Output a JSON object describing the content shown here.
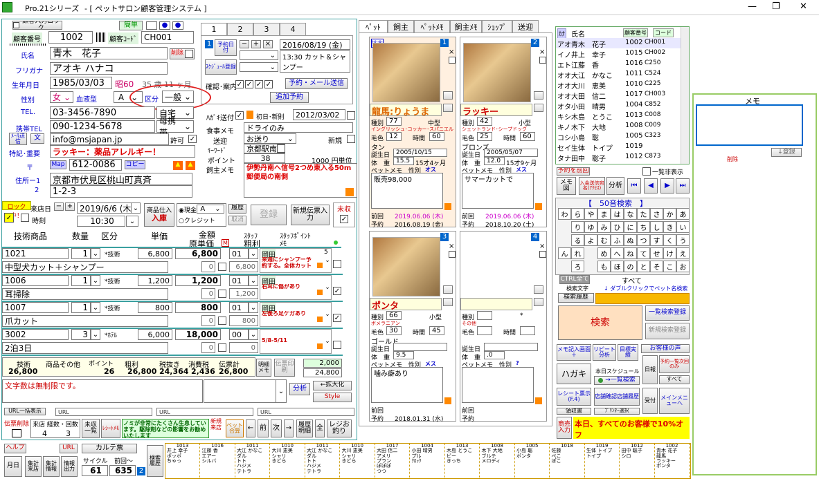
{
  "title": {
    "app": "Pro.21シリーズ",
    "system": "- [ ペットサロン顧客管理システム ]"
  },
  "win": {
    "min": "—",
    "restore": "❐",
    "close": "✕"
  },
  "top": {
    "lock_input": "顧客入力ロック",
    "id_label": "顧客番号",
    "id_value": "1002",
    "code_label": "顧客ｺｰﾄﾞ",
    "code_value": "CH001",
    "easy": "簡単"
  },
  "cust": {
    "name_label": "氏名",
    "name": "青木　花子",
    "delete": "削除",
    "furi_label": "フリガナ",
    "furi": "アオキ ハナコ",
    "dob_label": "生年月日",
    "dob": "1985/03/03",
    "era": "昭60",
    "age": "35 歳 11 ヶ月",
    "sex_label": "性別",
    "sex": "女",
    "blood_label": "血液型",
    "blood": "A",
    "kubun_label": "区分",
    "kubun": "一般",
    "tel_label": "TEL.",
    "tel": "03-3456-7890",
    "tel_type": "自宅",
    "mob_label": "携帯TEL",
    "mob": "090-1234-5678",
    "mob_type": "母携帯",
    "mail_btn": "ﾒｰﾙ送信",
    "mail_btn2": "文",
    "mail": "info@msjapan.jp",
    "permit": "許可",
    "note_label": "特記･重要",
    "note": "ラッキー：薬品アレルギー！",
    "zip_label": "〒",
    "map_btn": "Map",
    "zip": "612-0086",
    "copy_btn": "コピー",
    "addr1_label": "住所ー1",
    "addr1": "京都市伏見区桃山町真斉",
    "addr2_label": "2",
    "addr2": "1-2-3"
  },
  "tabs": {
    "t1": "1",
    "t2": "2",
    "t3": "3",
    "t4": "4"
  },
  "yoyaku": {
    "label": "予約日付",
    "minus": "−",
    "plus": "+",
    "x": "×",
    "date": "2016/08/19 (金)",
    "sched": "ｽｹｼﾞｭｰﾙ登録",
    "memo": "13:30 カット＆シャンプー",
    "confirm_label": "確認･案内",
    "mail_btn": "予約・メール送信",
    "add_btn": "追加予約"
  },
  "hagaki": {
    "label": "ﾊｶﾞｷ送付",
    "first_label": "初日･新則",
    "first_date": "2012/03/02",
    "shoku_label": "食事メモ",
    "shoku": "ドライのみ",
    "soge_label": "送迎",
    "soge": "お送り",
    "new_label": "新規",
    "kw_label": "ｷｰﾜｰﾄﾞ",
    "kw": "京都駅南口",
    "pt_label": "ポイント",
    "pt": "38",
    "pt_unit": "1000 円単位",
    "memo_label": "飼主メモ",
    "memo": "伊勢丹南へ信号2つめ東入る50m郵便局の南側"
  },
  "lock": {
    "tag": "ロック中！",
    "visit_label": "来店日",
    "date": "2019/6/6 (木)",
    "time": "10:30",
    "time_label": "時刻",
    "shiire": "商品仕入",
    "nyuko": "入庫",
    "genkin": "現金",
    "pay_a": "A",
    "credit": "クレジット",
    "rireki": "履歴",
    "torikeshi": "取消",
    "toroku": "登録",
    "new_slip": "新規伝票入力",
    "misyu": "未収"
  },
  "lines": {
    "h_item": "技術商品",
    "h_qty": "数量",
    "h_kubun": "区分",
    "h_price": "単価",
    "h_amount": "金額",
    "h_genka": "原単価",
    "h_staff": "ｽﾀｯﾌ",
    "h_arari": "粗利",
    "h_point": "ｽﾀｯﾌﾎﾟｲﾝﾄ",
    "h_memo": "ﾒﾓ",
    "h_m": "M",
    "rows": [
      {
        "code": "1021",
        "qty": "1",
        "kubun": "*技術",
        "price": "6,800",
        "amount": "6,800",
        "staff": "01",
        "name": "中型犬カット＋シャンプー",
        "genka": "0",
        "arari": "6,800",
        "sname": "岡田",
        "pt": "5",
        "smemo": "来週にシャンプー予約する。全体カット"
      },
      {
        "code": "1006",
        "qty": "1",
        "kubun": "*技術",
        "price": "1,200",
        "amount": "1,200",
        "staff": "01",
        "name": "耳掃除",
        "genka": "0",
        "arari": "1,200",
        "sname": "岡田",
        "pt": "",
        "smemo": "右耳に傷があり"
      },
      {
        "code": "1007",
        "qty": "1",
        "kubun": "*技術",
        "price": "800",
        "amount": "800",
        "staff": "01",
        "name": "爪カット",
        "genka": "0",
        "arari": "800",
        "sname": "岡田",
        "pt": "",
        "smemo": "左後ろ足ケガあり"
      },
      {
        "code": "3002",
        "qty": "3",
        "kubun": "*ﾎﾃﾙ",
        "price": "6,000",
        "amount": "18,000",
        "staff": "00",
        "name": "2泊3日",
        "genka": "0",
        "arari": "0",
        "sname": "",
        "pt": "",
        "smemo": "5/8-5/11"
      }
    ]
  },
  "totals": {
    "h_gijutsu": "技術",
    "h_shohin": "商品その他",
    "h_point": "ポイント",
    "h_arari": "粗利",
    "h_nuki": "税抜き",
    "h_tax": "消費税",
    "h_total": "伝票計",
    "gijutsu": "26,800",
    "shohin": "",
    "point": "26",
    "arari": "26,800",
    "nuki": "24,364",
    "tax": "2,436",
    "total": "26,800",
    "meisai": "明細メモ",
    "print": "伝票印刷",
    "v1": "2,000",
    "v2": "24,800"
  },
  "bottom": {
    "free": "文字数は無制限です。",
    "bunseki": "分析",
    "kakudai": "←拡大化",
    "style": "Style",
    "url_btn": "URL一括表示",
    "url": "URL",
    "lock_del": "伝票削除",
    "visit_label": "来店 経数・回数",
    "visit_a": "4",
    "visit_b": "3",
    "mishu": "未収一覧",
    "receipt": "ﾚｼｰﾄﾒﾓ",
    "notice": "ノミが非常にたくさん生息しています。駆除剤などの影響をお勧めいたします",
    "newcust": "新規来店",
    "pet_calc": "ペット合算",
    "prev": "←",
    "mae": "前",
    "next": "次",
    "arrow": "→",
    "rireki": "履歴明細",
    "all": "全",
    "reji": "レジお釣り",
    "help": "ヘルプ",
    "karte": "カルテ票",
    "gekko": "月日",
    "nyuko": "集計来店",
    "shukei": "集計情報",
    "joho": "情報出力",
    "cycle": "サイクル",
    "prevday": "前回〜",
    "v61": "61",
    "v635": "635",
    "n2": "2",
    "kensaku": "検索履歴",
    "yoyaku": "予約"
  },
  "pettabs": {
    "pet": "ﾍﾟｯﾄ",
    "owner": "飼主",
    "petmemo": "ﾍﾟｯﾄﾒﾓ",
    "ownermemo": "飼主ﾒﾓ",
    "shop": "ｼｮｯﾌﾟ",
    "soge": "送迎"
  },
  "pets": [
    {
      "num": "1",
      "kakudai": "拡大",
      "name": "龍馬:りょうま",
      "type_label": "種別",
      "type": "77",
      "size": "中型",
      "breed": "イングリッシュ･コッカー･スパニエル",
      "color_label": "毛色",
      "color_code": "12",
      "time_label": "時間",
      "time": "60",
      "color": "タン",
      "bd_label": "誕生日",
      "bd": "2005/10/15",
      "wt_label": "体　重",
      "wt": "15.5",
      "age": "15才4ヶ月",
      "pm_label": "ペットメモ",
      "sex_label": "性別",
      "sex": "オス",
      "memo": "販売98,000",
      "prev_label": "前回",
      "prev": "2019.06.06 (木)",
      "next_label": "予約",
      "next": "2016.08.19 (金)"
    },
    {
      "num": "2",
      "name": "ラッキー",
      "type_label": "種別",
      "type": "42",
      "size": "小型",
      "breed": "シェットランド･シープドッグ",
      "color_label": "毛色",
      "color_code": "25",
      "time_label": "時間",
      "time": "60",
      "color": "ブロンズ",
      "bd_label": "誕生日",
      "bd": "2005/05/07",
      "wt_label": "体　重",
      "wt": "12.0",
      "age": "15才9ヶ月",
      "pm_label": "ペットメモ",
      "sex_label": "性別",
      "sex": "メス",
      "memo": "サマーカットで",
      "prev_label": "前回",
      "prev": "2019.06.06 (木)",
      "next_label": "予約",
      "next": "2018.10.20 (土)"
    },
    {
      "num": "3",
      "name": "ポンタ",
      "type_label": "種別",
      "type": "66",
      "size": "小型",
      "breed": "ポメラニアン",
      "color_label": "毛色",
      "color_code": "30",
      "time_label": "時間",
      "time": "45",
      "color": "ゴールド",
      "bd_label": "誕生日",
      "bd": "",
      "wt_label": "体　重",
      "wt": "9.5",
      "age": "",
      "pm_label": "ペットメモ",
      "sex_label": "性別",
      "sex": "メス",
      "memo": "噛み癖あり",
      "prev_label": "前回",
      "prev": "",
      "next_label": "予約",
      "next": "2018.01.31 (水)"
    },
    {
      "num": "4",
      "name": "",
      "type_label": "種別",
      "type": "",
      "size": "*",
      "breed": "その他",
      "color_label": "毛色",
      "color_code": "",
      "time_label": "時間",
      "time": "",
      "color": "",
      "bd_label": "誕生日",
      "bd": "",
      "wt_label": "体　重",
      "wt": ".0",
      "age": "",
      "pm_label": "ペットメモ",
      "sex_label": "性別",
      "sex": "?",
      "memo": "",
      "prev_label": "前回",
      "prev": "",
      "next_label": "予約",
      "next": ""
    }
  ],
  "clist": {
    "h_kana": "ｶﾅ",
    "h_name": "氏名",
    "h_num": "顧客番号",
    "h_code": "コード",
    "rows": [
      [
        "アオ",
        "青木　花子",
        "1002",
        "CH001"
      ],
      [
        "イノ",
        "井上　幸子",
        "1015",
        "CH002"
      ],
      [
        "エト",
        "江藤　香",
        "1016",
        "C250"
      ],
      [
        "オオ",
        "大江　かなこ",
        "1011",
        "C524"
      ],
      [
        "オオ",
        "大川　恵美",
        "1010",
        "C225"
      ],
      [
        "オオ",
        "大田　信二",
        "1017",
        "CH003"
      ],
      [
        "オタ",
        "小田　晴男",
        "1004",
        "C852"
      ],
      [
        "キシ",
        "木島　とうこ",
        "1013",
        "C008"
      ],
      [
        "キノ",
        "木下　大地",
        "1008",
        "C009"
      ],
      [
        "コシ",
        "小島　聡",
        "1005",
        "C323"
      ],
      [
        "セイ",
        "生体　トイプ",
        "1019",
        ""
      ],
      [
        "タナ",
        "田中　聡子",
        "1012",
        "C873"
      ]
    ]
  },
  "right": {
    "yoyaku_mae": "予約を前回",
    "ichiran": "一覧非表示",
    "memo_btn": "メモ図",
    "nyukin": "入金送信宛名(ｱｸｾｽ)",
    "bunseki": "分析",
    "gojuon": "【　50音検索　】",
    "clear": "CTRL全て",
    "subete": "すべて",
    "kensaku_moji": "検索文字",
    "dbl": "↓ ダブルクリックでペット名検索",
    "kensaku_rireki": "検索履歴",
    "kensaku": "検索",
    "ikkatsu": "一覧検索登録",
    "shinki": "新規",
    "kensaku_toroku": "新規検索登録",
    "memo_kinyu": "メモ記入画面＋",
    "repeat": "リピート分析",
    "mokuhyo": "目標実績",
    "voice": "お客様の声",
    "hagaki": "ハガキ",
    "honjitsu": "本日スケジュール",
    "ichiran_kensaku": "→一覧検索",
    "nichi": "日報",
    "yoyaku_ichi": "予約一覧次回のみ",
    "subete2": "すべて",
    "receipt": "レシート票示(F.4)",
    "shinki_ichi": "店舗確認店舗履歴",
    "uketsuke": "受付",
    "main_menu": "メインメニューへ",
    "ryoshu": "領収書",
    "printer": "ﾌﾟﾘﾝﾀｰ選択",
    "shobai": "商売入力",
    "banner": "本日、すべてのお客様で10%オフ"
  },
  "kana": [
    [
      "わ",
      "ら",
      "や",
      "ま",
      "は",
      "な",
      "た",
      "さ",
      "か",
      "あ"
    ],
    [
      "",
      "り",
      "ゆ",
      "み",
      "ひ",
      "に",
      "ち",
      "し",
      "き",
      "い"
    ],
    [
      "",
      "る",
      "よ",
      "む",
      "ふ",
      "ぬ",
      "つ",
      "す",
      "く",
      "う"
    ],
    [
      "ん",
      "れ",
      "",
      "め",
      "へ",
      "ね",
      "て",
      "せ",
      "け",
      "え"
    ],
    [
      "",
      "ろ",
      "",
      "も",
      "ほ",
      "の",
      "と",
      "そ",
      "こ",
      "お"
    ]
  ],
  "memo_panel": {
    "title": "メモ",
    "kiroku": "↓登録",
    "sakujo": "削除"
  },
  "cal": [
    {
      "num": "1013",
      "l1": "井上 幸子",
      "l2": "ポッポ",
      "l3": "ちゃっ"
    },
    {
      "num": "1016",
      "l1": "江藤 香",
      "l2": "エアー",
      "l3": "シルバ"
    },
    {
      "num": "1011",
      "l1": "大江 かなこ",
      "l2": "ダル",
      "l3": "トト",
      "l4": "ハジメ",
      "l5": "テトラ"
    },
    {
      "num": "1010",
      "l1": "大川 恵美",
      "l2": "シャリ",
      "l3": "きどら"
    },
    {
      "num": "1011",
      "l1": "大江 かなこ",
      "l2": "ダル",
      "l3": "トト",
      "l4": "ハジメ",
      "l5": "テトラ"
    },
    {
      "num": "1010",
      "l1": "大川 恵美",
      "l2": "シャリ",
      "l3": "きどら"
    },
    {
      "num": "1017",
      "l1": "大田 信二",
      "l2": "アメリ",
      "l3": "プラン",
      "l4": "ぽぽぽ",
      "l5": "つつ"
    },
    {
      "num": "1004",
      "l1": "小田 晴男",
      "l2": "プル",
      "l3": "ｸﾛｯｸ"
    },
    {
      "num": "1013",
      "l1": "木島 とうこ",
      "l2": "ビー",
      "l3": "きっち"
    },
    {
      "num": "1008",
      "l1": "木下 大地",
      "l2": "ブルテ",
      "l3": "メロディ"
    },
    {
      "num": "1005",
      "l1": "小島 聡",
      "l2": "ポンタ"
    },
    {
      "num": "1018",
      "l1": "佐藤",
      "l2": "ぺこ",
      "l3": "ぽこ"
    },
    {
      "num": "1019",
      "l1": "生体 トイプ",
      "l2": "トイプ"
    },
    {
      "num": "1012",
      "l1": "田中 聡子",
      "l2": "シロ"
    },
    {
      "num": "1002",
      "l1": "青木 花子",
      "l2": "龍馬",
      "l3": "ラッキー",
      "l4": "ポンタ"
    }
  ],
  "colors": {
    "accent": "#0000cc",
    "warn": "#d00",
    "green_frame": "#99cc66",
    "orange": "#ffa500"
  }
}
